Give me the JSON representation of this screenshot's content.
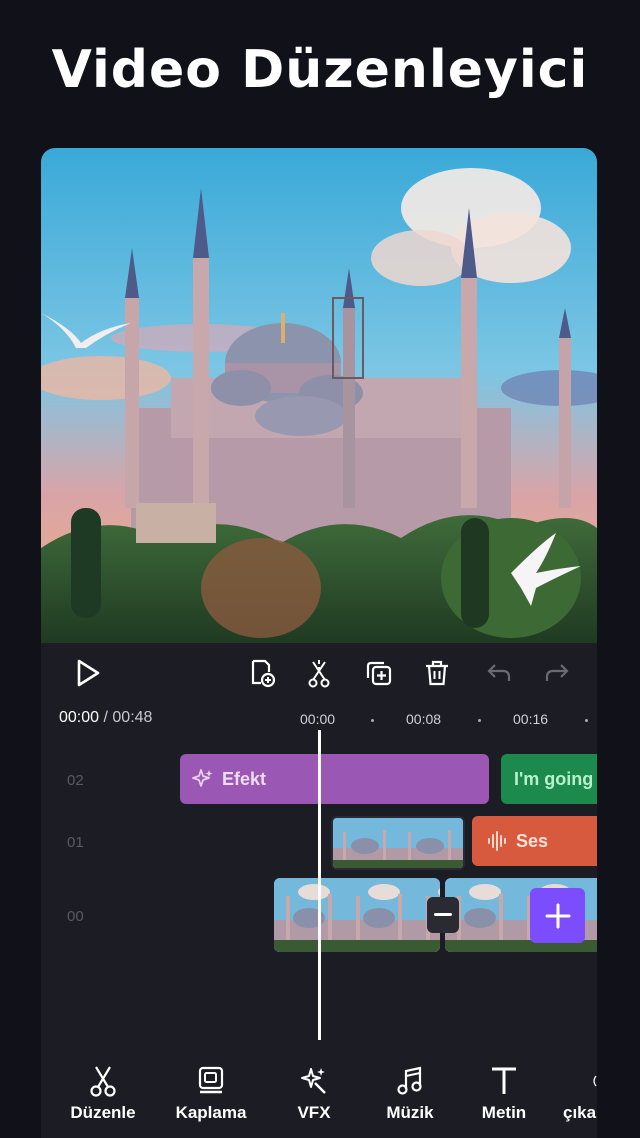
{
  "headline": "Video Düzenleyici",
  "controls": {
    "play": "play-icon",
    "add_clip": "add-clip-icon",
    "split": "split-icon",
    "duplicate": "duplicate-icon",
    "delete": "delete-icon",
    "undo": "undo-icon",
    "redo": "redo-icon"
  },
  "timeline": {
    "current_time": "00:00",
    "separator": " / ",
    "total_time": "00:48",
    "ticks": [
      "00:00",
      "00:08",
      "00:16"
    ]
  },
  "tracks": {
    "labels": [
      "02",
      "01",
      "00"
    ],
    "effect_clip": "Efekt",
    "text_clip": "I'm going",
    "audio_clip": "Ses"
  },
  "toolbar": {
    "items": [
      "Düzenle",
      "Kaplama",
      "VFX",
      "Müzik",
      "Metin",
      "çıka"
    ]
  },
  "colors": {
    "background": "#11111a",
    "panel": "#1c1c24",
    "effect": "#9a58b4",
    "text_clip": "#1c8a4c",
    "audio": "#d85a3e",
    "accent": "#7b4dff"
  }
}
